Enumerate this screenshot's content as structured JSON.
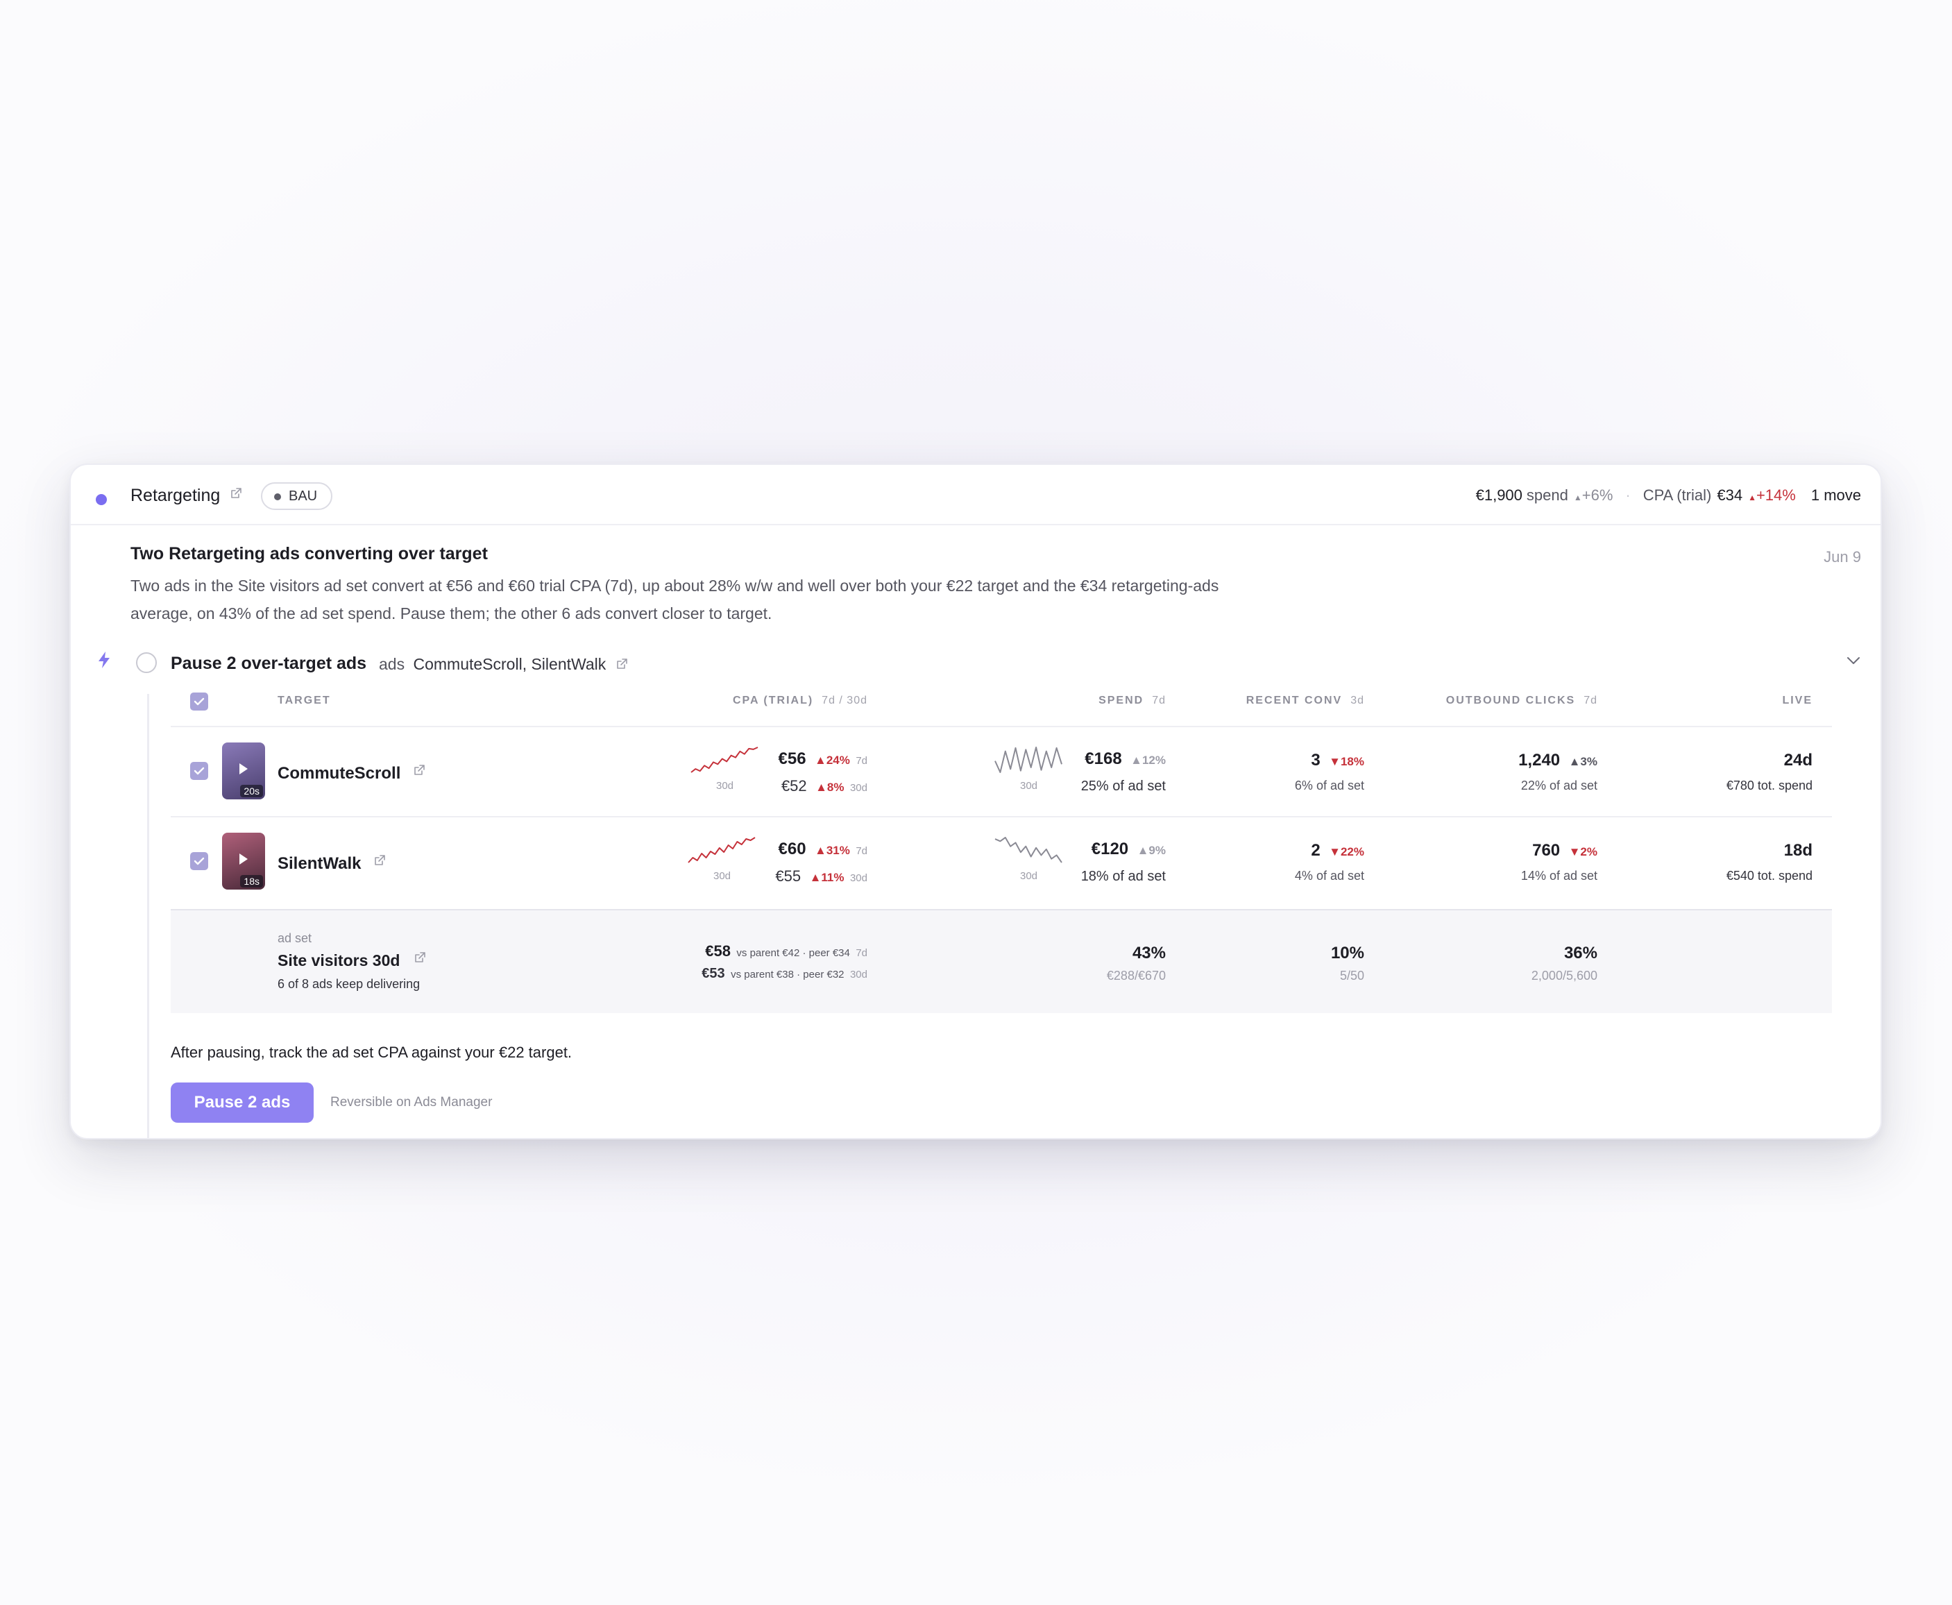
{
  "header": {
    "campaign": "Retargeting",
    "badge": "BAU",
    "spend_value": "€1,900",
    "spend_label": "spend",
    "spend_delta": "+6%",
    "separator": "·",
    "cpa_label": "CPA (trial)",
    "cpa_value": "€34",
    "cpa_delta": "+14%",
    "moves": "1 move"
  },
  "insight": {
    "title": "Two Retargeting ads converting over target",
    "date": "Jun 9",
    "description": "Two ads in the Site visitors ad set convert at €56 and €60 trial CPA (7d), up about 28% w/w and well over both your €22 target and the €34 retargeting-ads average, on 43% of the ad set spend. Pause them; the other 6 ads convert closer to target."
  },
  "action": {
    "title": "Pause 2 over-target ads",
    "ads_prefix": "ads",
    "ads_list": "CommuteScroll, SilentWalk"
  },
  "table": {
    "columns": {
      "target": "TARGET",
      "cpa": "CPA (TRIAL)",
      "cpa_sub": "7d / 30d",
      "spend": "SPEND",
      "spend_sub": "7d",
      "conv": "RECENT CONV",
      "conv_sub": "3d",
      "clicks": "OUTBOUND CLICKS",
      "clicks_sub": "7d",
      "live": "LIVE"
    },
    "rows": [
      {
        "name": "CommuteScroll",
        "duration": "20s",
        "thumb_colors": [
          "#8a7ab8",
          "#4a3f6e"
        ],
        "cpa7": "€56",
        "cpa7_delta": "▲24%",
        "cpa7_period": "7d",
        "cpa30": "€52",
        "cpa30_delta": "▲8%",
        "cpa30_period": "30d",
        "spark_label": "30d",
        "cpa_spark": [
          2,
          3,
          2.4,
          4,
          3.2,
          5,
          4.4,
          6,
          5.2,
          7,
          6.4,
          8.2,
          7.4,
          9,
          8.8,
          9.4
        ],
        "spend": "€168",
        "spend_delta": "▲12%",
        "spend_share": "25% of ad set",
        "spend_spark": [
          5,
          1.5,
          8,
          2.5,
          9,
          2,
          8.5,
          3,
          9.2,
          2.2,
          8,
          3,
          9,
          4
        ],
        "conv": "3",
        "conv_delta": "▼18%",
        "conv_share": "6% of ad set",
        "clicks": "1,240",
        "clicks_delta": "▲3%",
        "clicks_share": "22% of ad set",
        "live": "24d",
        "live_spend": "€780 tot. spend"
      },
      {
        "name": "SilentWalk",
        "duration": "18s",
        "thumb_colors": [
          "#b0607a",
          "#4a2a3a"
        ],
        "cpa7": "€60",
        "cpa7_delta": "▲31%",
        "cpa7_period": "7d",
        "cpa30": "€55",
        "cpa30_delta": "▲11%",
        "cpa30_period": "30d",
        "spark_label": "30d",
        "cpa_spark": [
          2,
          3.4,
          2.6,
          4.6,
          3.4,
          5.2,
          4.4,
          6.2,
          5,
          7,
          6,
          8,
          7.2,
          8.8,
          8.4,
          9.2
        ],
        "spend": "€120",
        "spend_delta": "▲9%",
        "spend_share": "18% of ad set",
        "spend_spark": [
          8.6,
          8,
          9,
          6.6,
          7.6,
          5,
          6.6,
          3.8,
          6.2,
          4.2,
          5.8,
          3.2,
          4.2,
          2.2
        ],
        "conv": "2",
        "conv_delta": "▼22%",
        "conv_share": "4% of ad set",
        "clicks": "760",
        "clicks_delta": "▼2%",
        "clicks_share": "14% of ad set",
        "live": "18d",
        "live_spend": "€540 tot. spend"
      }
    ],
    "summary": {
      "kind": "ad set",
      "name": "Site visitors 30d",
      "note": "6 of 8 ads keep delivering",
      "cpa7": "€58",
      "cpa7_context": "vs parent €42 · peer €34",
      "cpa7_period": "7d",
      "cpa30": "€53",
      "cpa30_context": "vs parent €38 · peer €32",
      "cpa30_period": "30d",
      "spend": "43%",
      "spend_detail": "€288/€670",
      "conv": "10%",
      "conv_detail": "5/50",
      "clicks": "36%",
      "clicks_detail": "2,000/5,600"
    }
  },
  "footer": {
    "note": "After pausing, track the ad set CPA against your €22 target.",
    "button": "Pause 2 ads",
    "reversible": "Reversible on Ads Manager"
  },
  "colors": {
    "accent": "#8f82f2",
    "status_dot": "#7a6df0",
    "negative": "#c5313a",
    "spark_red": "#c5313a",
    "spark_grey": "#8a8a94"
  }
}
